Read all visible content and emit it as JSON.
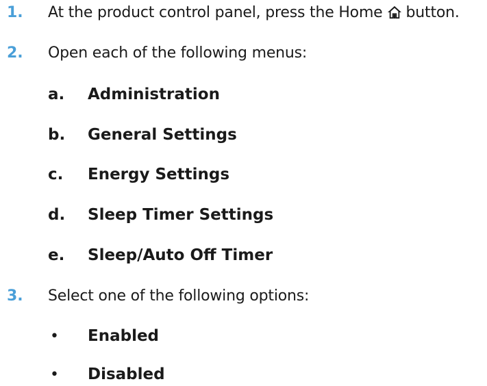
{
  "steps": [
    {
      "number": "1.",
      "text_before_icon": "At the product control panel, press the Home",
      "icon": "home-icon",
      "text_after_icon": "button."
    },
    {
      "number": "2.",
      "text": "Open each of the following menus:",
      "substeps": [
        {
          "letter": "a.",
          "label": "Administration"
        },
        {
          "letter": "b.",
          "label": "General Settings"
        },
        {
          "letter": "c.",
          "label": "Energy Settings"
        },
        {
          "letter": "d.",
          "label": "Sleep Timer Settings"
        },
        {
          "letter": "e.",
          "label": "Sleep/Auto Off Timer"
        }
      ]
    },
    {
      "number": "3.",
      "text": "Select one of the following options:",
      "options": [
        {
          "bullet": "•",
          "label": "Enabled"
        },
        {
          "bullet": "•",
          "label": "Disabled"
        }
      ]
    }
  ],
  "colors": {
    "step_number": "#4a9fd8",
    "text": "#1a1a1a"
  }
}
